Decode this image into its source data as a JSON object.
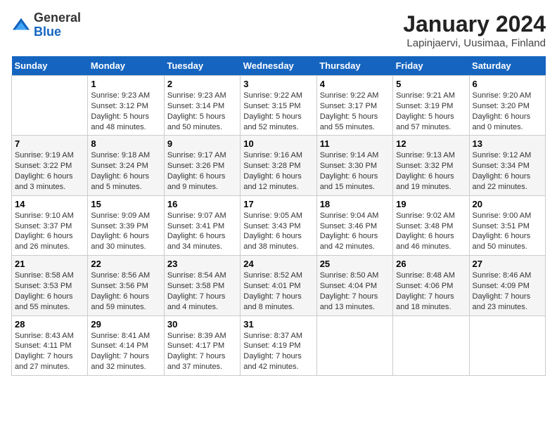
{
  "logo": {
    "general": "General",
    "blue": "Blue"
  },
  "title": "January 2024",
  "subtitle": "Lapinjaervi, Uusimaa, Finland",
  "days_header": [
    "Sunday",
    "Monday",
    "Tuesday",
    "Wednesday",
    "Thursday",
    "Friday",
    "Saturday"
  ],
  "weeks": [
    [
      {
        "day": "",
        "content": ""
      },
      {
        "day": "1",
        "content": "Sunrise: 9:23 AM\nSunset: 3:12 PM\nDaylight: 5 hours\nand 48 minutes."
      },
      {
        "day": "2",
        "content": "Sunrise: 9:23 AM\nSunset: 3:14 PM\nDaylight: 5 hours\nand 50 minutes."
      },
      {
        "day": "3",
        "content": "Sunrise: 9:22 AM\nSunset: 3:15 PM\nDaylight: 5 hours\nand 52 minutes."
      },
      {
        "day": "4",
        "content": "Sunrise: 9:22 AM\nSunset: 3:17 PM\nDaylight: 5 hours\nand 55 minutes."
      },
      {
        "day": "5",
        "content": "Sunrise: 9:21 AM\nSunset: 3:19 PM\nDaylight: 5 hours\nand 57 minutes."
      },
      {
        "day": "6",
        "content": "Sunrise: 9:20 AM\nSunset: 3:20 PM\nDaylight: 6 hours\nand 0 minutes."
      }
    ],
    [
      {
        "day": "7",
        "content": "Sunrise: 9:19 AM\nSunset: 3:22 PM\nDaylight: 6 hours\nand 3 minutes."
      },
      {
        "day": "8",
        "content": "Sunrise: 9:18 AM\nSunset: 3:24 PM\nDaylight: 6 hours\nand 5 minutes."
      },
      {
        "day": "9",
        "content": "Sunrise: 9:17 AM\nSunset: 3:26 PM\nDaylight: 6 hours\nand 9 minutes."
      },
      {
        "day": "10",
        "content": "Sunrise: 9:16 AM\nSunset: 3:28 PM\nDaylight: 6 hours\nand 12 minutes."
      },
      {
        "day": "11",
        "content": "Sunrise: 9:14 AM\nSunset: 3:30 PM\nDaylight: 6 hours\nand 15 minutes."
      },
      {
        "day": "12",
        "content": "Sunrise: 9:13 AM\nSunset: 3:32 PM\nDaylight: 6 hours\nand 19 minutes."
      },
      {
        "day": "13",
        "content": "Sunrise: 9:12 AM\nSunset: 3:34 PM\nDaylight: 6 hours\nand 22 minutes."
      }
    ],
    [
      {
        "day": "14",
        "content": "Sunrise: 9:10 AM\nSunset: 3:37 PM\nDaylight: 6 hours\nand 26 minutes."
      },
      {
        "day": "15",
        "content": "Sunrise: 9:09 AM\nSunset: 3:39 PM\nDaylight: 6 hours\nand 30 minutes."
      },
      {
        "day": "16",
        "content": "Sunrise: 9:07 AM\nSunset: 3:41 PM\nDaylight: 6 hours\nand 34 minutes."
      },
      {
        "day": "17",
        "content": "Sunrise: 9:05 AM\nSunset: 3:43 PM\nDaylight: 6 hours\nand 38 minutes."
      },
      {
        "day": "18",
        "content": "Sunrise: 9:04 AM\nSunset: 3:46 PM\nDaylight: 6 hours\nand 42 minutes."
      },
      {
        "day": "19",
        "content": "Sunrise: 9:02 AM\nSunset: 3:48 PM\nDaylight: 6 hours\nand 46 minutes."
      },
      {
        "day": "20",
        "content": "Sunrise: 9:00 AM\nSunset: 3:51 PM\nDaylight: 6 hours\nand 50 minutes."
      }
    ],
    [
      {
        "day": "21",
        "content": "Sunrise: 8:58 AM\nSunset: 3:53 PM\nDaylight: 6 hours\nand 55 minutes."
      },
      {
        "day": "22",
        "content": "Sunrise: 8:56 AM\nSunset: 3:56 PM\nDaylight: 6 hours\nand 59 minutes."
      },
      {
        "day": "23",
        "content": "Sunrise: 8:54 AM\nSunset: 3:58 PM\nDaylight: 7 hours\nand 4 minutes."
      },
      {
        "day": "24",
        "content": "Sunrise: 8:52 AM\nSunset: 4:01 PM\nDaylight: 7 hours\nand 8 minutes."
      },
      {
        "day": "25",
        "content": "Sunrise: 8:50 AM\nSunset: 4:04 PM\nDaylight: 7 hours\nand 13 minutes."
      },
      {
        "day": "26",
        "content": "Sunrise: 8:48 AM\nSunset: 4:06 PM\nDaylight: 7 hours\nand 18 minutes."
      },
      {
        "day": "27",
        "content": "Sunrise: 8:46 AM\nSunset: 4:09 PM\nDaylight: 7 hours\nand 23 minutes."
      }
    ],
    [
      {
        "day": "28",
        "content": "Sunrise: 8:43 AM\nSunset: 4:11 PM\nDaylight: 7 hours\nand 27 minutes."
      },
      {
        "day": "29",
        "content": "Sunrise: 8:41 AM\nSunset: 4:14 PM\nDaylight: 7 hours\nand 32 minutes."
      },
      {
        "day": "30",
        "content": "Sunrise: 8:39 AM\nSunset: 4:17 PM\nDaylight: 7 hours\nand 37 minutes."
      },
      {
        "day": "31",
        "content": "Sunrise: 8:37 AM\nSunset: 4:19 PM\nDaylight: 7 hours\nand 42 minutes."
      },
      {
        "day": "",
        "content": ""
      },
      {
        "day": "",
        "content": ""
      },
      {
        "day": "",
        "content": ""
      }
    ]
  ]
}
